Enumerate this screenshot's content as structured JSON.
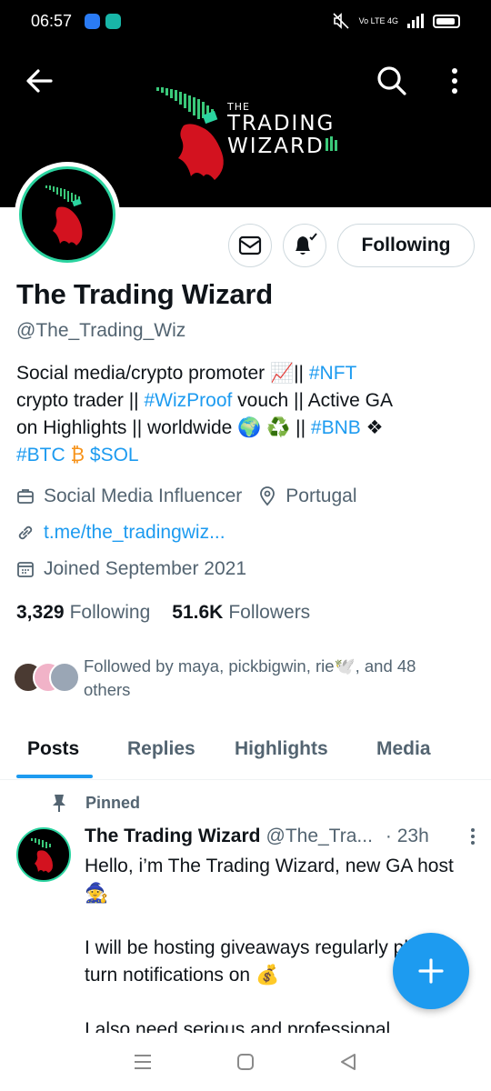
{
  "status_bar": {
    "time": "06:57",
    "network_label": "Vo LTE 4G",
    "app_colors": [
      "#2a7bf5",
      "#18b6a8"
    ]
  },
  "banner": {
    "logo_word_1": "THE",
    "logo_word_2": "TRADING",
    "logo_word_3": "WIZARD",
    "background": "#000000"
  },
  "profile": {
    "display_name": "The Trading Wizard",
    "handle": "@The_Trading_Wiz",
    "following_button": "Following",
    "bio": {
      "line1_text": "Social media/crypto promoter 📈|| ",
      "line1_tag": "#NFT",
      "line2_text_a": "crypto trader || ",
      "line2_tag": "#WizProof",
      "line2_text_b": " vouch || Active GA",
      "line3_text": "on Highlights || worldwide 🌍 ♻️ || ",
      "line3_tag": "#BNB",
      "line3_emoji": " ❖",
      "line4_tag1": "#BTC",
      "line4_emoji": " ₿  ",
      "line4_tag2": "$SOL"
    },
    "category": "Social Media Influencer",
    "location": "Portugal",
    "link": "t.me/the_tradingwiz...",
    "joined": "Joined September 2021",
    "following_count": "3,329",
    "following_label": "Following",
    "followers_count": "51.6K",
    "followers_label": "Followers",
    "followed_by": "Followed by maya, pickbigwin, rie🕊️, and 48 others"
  },
  "tabs": [
    "Posts",
    "Replies",
    "Highlights",
    "Media"
  ],
  "post": {
    "pinned_label": "Pinned",
    "author": "The Trading Wizard",
    "handle": "@The_Tra...",
    "time": "· 23h",
    "body": "Hello, i’m The Trading Wizard, new GA host 🧙\n\nI will be hosting giveaways regularly please turn notifications on 💰\n\nI also need serious and professional"
  },
  "colors": {
    "accent": "#1d9bf0",
    "text": "#0f1419",
    "secondary": "#536471",
    "avatar_ring": "#2bd4a0"
  }
}
